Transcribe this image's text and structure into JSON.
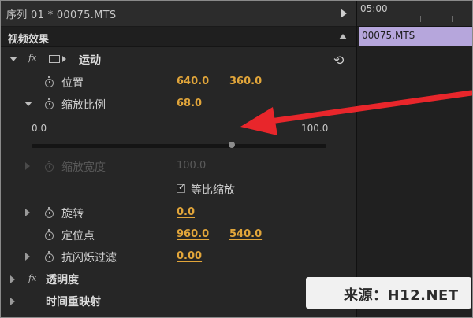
{
  "sequence": {
    "title": "序列 01 * 00075.MTS"
  },
  "effects_panel": {
    "title": "视频效果",
    "motion": {
      "label": "运动",
      "position": {
        "label": "位置",
        "x": "640.0",
        "y": "360.0"
      },
      "scale": {
        "label": "缩放比例",
        "value": "68.0",
        "slider_min": "0.0",
        "slider_max": "100.0",
        "slider_fraction": 0.68
      },
      "scale_width": {
        "label": "缩放宽度",
        "value": "100.0"
      },
      "uniform_scale": {
        "label": "等比缩放",
        "checked": true
      },
      "rotation": {
        "label": "旋转",
        "value": "0.0"
      },
      "anchor": {
        "label": "定位点",
        "x": "960.0",
        "y": "540.0"
      },
      "anti_flicker": {
        "label": "抗闪烁过滤",
        "value": "0.00"
      }
    },
    "opacity": {
      "label": "透明度"
    },
    "time_remap": {
      "label": "时间重映射"
    }
  },
  "timeline": {
    "time": "05:00",
    "clip_name": "00075.MTS",
    "clip_color": "#b6a6dc"
  },
  "watermark": {
    "text": "来源：H12.NET"
  },
  "colors": {
    "value_orange": "#e1a53a",
    "arrow_red": "#e8262b"
  },
  "icons": [
    "stopwatch-icon",
    "motion-icon",
    "reset-icon",
    "fx-icon",
    "checkmark-icon"
  ]
}
